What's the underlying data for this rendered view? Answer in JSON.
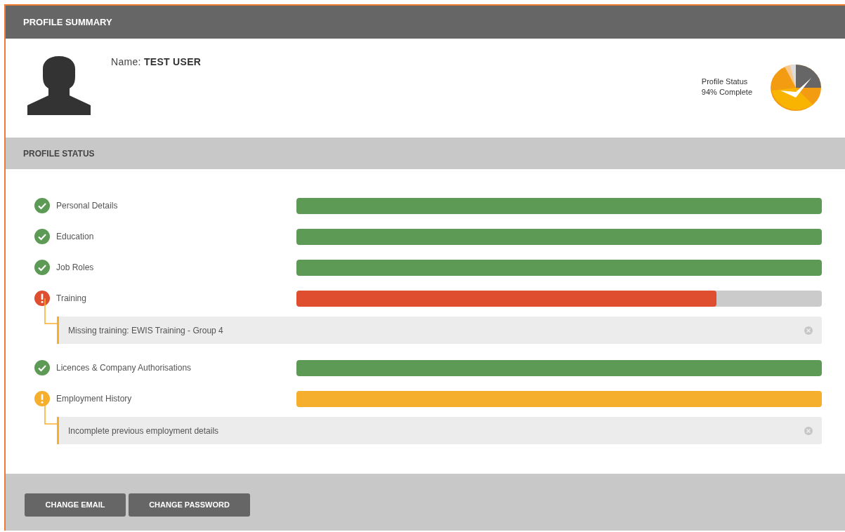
{
  "header": {
    "title": "PROFILE SUMMARY"
  },
  "profile": {
    "name": "Name: **TEST USER**",
    "status_label": "Profile Status",
    "status_value": "94% Complete"
  },
  "status_section": {
    "title": "PROFILE STATUS"
  },
  "items": [
    {
      "label": "Personal Details",
      "kind": "ok",
      "level": 1
    },
    {
      "label": "Education",
      "kind": "ok",
      "level": 1
    },
    {
      "label": "Job Roles",
      "kind": "ok",
      "level": 1
    },
    {
      "label": "Training",
      "kind": "error",
      "level": 0.8,
      "issue": "Missing training: EWIS Training - Group 4"
    },
    {
      "label": "Licences & Company Authorisations",
      "kind": "ok",
      "level": 1
    },
    {
      "label": "Employment History",
      "kind": "warning",
      "level": 1,
      "issue": "Incomplete previous employment details"
    }
  ],
  "buttons": [
    "CHANGE EMAIL",
    "CHANGE PASSWORD"
  ]
}
